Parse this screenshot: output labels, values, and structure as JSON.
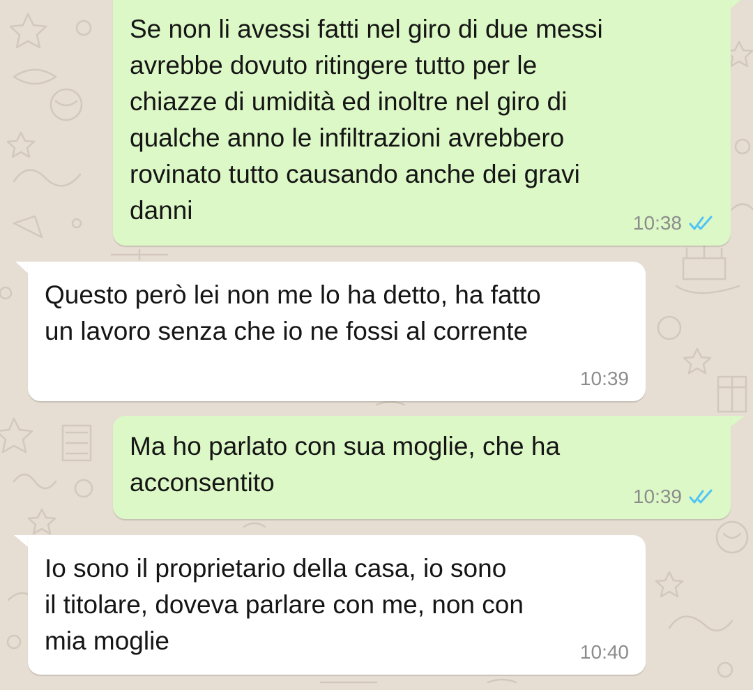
{
  "colors": {
    "outgoing_bubble": "#dcf8c6",
    "incoming_bubble": "#ffffff",
    "wallpaper": "#e6ddd3",
    "read_ticks": "#4fc3f7",
    "timestamp": "#8c8c8c"
  },
  "messages": [
    {
      "direction": "outgoing",
      "text": "Se non li avessi fatti nel giro di due messi\navrebbe dovuto ritingere tutto per le\nchiazze di umidità ed inoltre nel giro di\nqualche anno le infiltrazioni avrebbero\nrovinato tutto causando anche dei gravi\ndanni",
      "time": "10:38",
      "status_icon": "double-check-read-icon"
    },
    {
      "direction": "incoming",
      "text": "Questo però lei non me lo ha detto, ha fatto\nun lavoro senza che io ne fossi al corrente",
      "time": "10:39"
    },
    {
      "direction": "outgoing",
      "text": "Ma ho parlato con sua moglie, che ha\nacconsentito",
      "time": "10:39",
      "status_icon": "double-check-read-icon"
    },
    {
      "direction": "incoming",
      "text": "Io sono il proprietario della casa, io sono\nil titolare, doveva parlare con me, non con\nmia moglie",
      "time": "10:40"
    }
  ]
}
